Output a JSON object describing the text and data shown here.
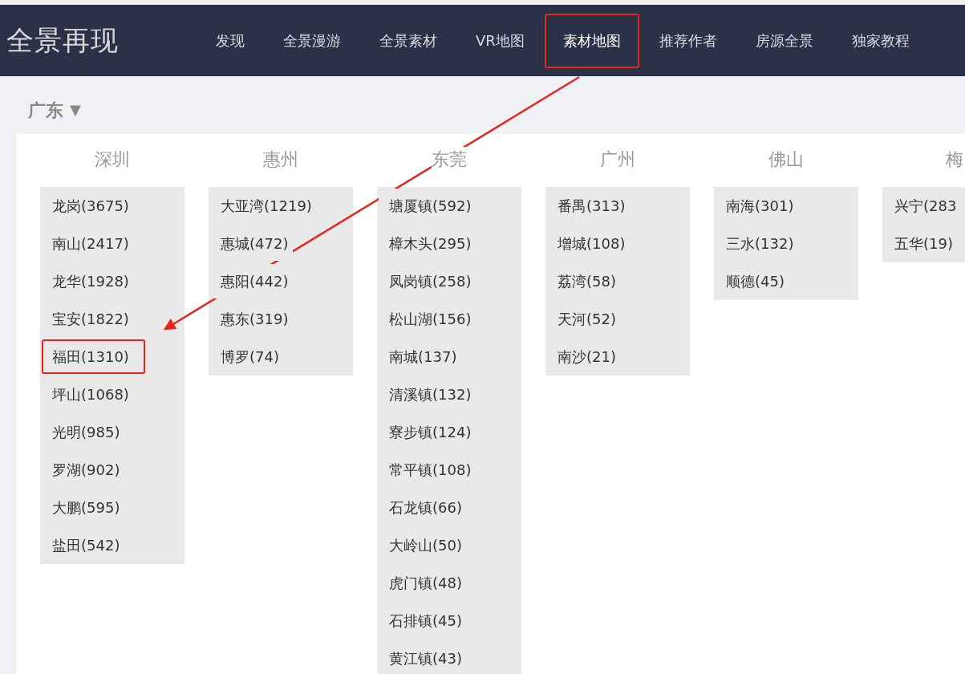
{
  "logo": "全景再现",
  "nav": [
    {
      "label": "发现",
      "highlighted": false
    },
    {
      "label": "全景漫游",
      "highlighted": false
    },
    {
      "label": "全景素材",
      "highlighted": false
    },
    {
      "label": "VR地图",
      "highlighted": false
    },
    {
      "label": "素材地图",
      "highlighted": true
    },
    {
      "label": "推荐作者",
      "highlighted": false
    },
    {
      "label": "房源全景",
      "highlighted": false
    },
    {
      "label": "独家教程",
      "highlighted": false
    }
  ],
  "province": {
    "label": "广东",
    "caret": "▼"
  },
  "cities": [
    {
      "name": "深圳",
      "districts": [
        {
          "label": "龙岗(3675)",
          "highlighted": false
        },
        {
          "label": "南山(2417)",
          "highlighted": false
        },
        {
          "label": "龙华(1928)",
          "highlighted": false
        },
        {
          "label": "宝安(1822)",
          "highlighted": false
        },
        {
          "label": "福田(1310)",
          "highlighted": true
        },
        {
          "label": "坪山(1068)",
          "highlighted": false
        },
        {
          "label": "光明(985)",
          "highlighted": false
        },
        {
          "label": "罗湖(902)",
          "highlighted": false
        },
        {
          "label": "大鹏(595)",
          "highlighted": false
        },
        {
          "label": "盐田(542)",
          "highlighted": false
        }
      ]
    },
    {
      "name": "惠州",
      "districts": [
        {
          "label": "大亚湾(1219)",
          "highlighted": false
        },
        {
          "label": "惠城(472)",
          "highlighted": false
        },
        {
          "label": "惠阳(442)",
          "highlighted": false
        },
        {
          "label": "惠东(319)",
          "highlighted": false
        },
        {
          "label": "博罗(74)",
          "highlighted": false
        }
      ]
    },
    {
      "name": "东莞",
      "districts": [
        {
          "label": "塘厦镇(592)",
          "highlighted": false
        },
        {
          "label": "樟木头(295)",
          "highlighted": false
        },
        {
          "label": "凤岗镇(258)",
          "highlighted": false
        },
        {
          "label": "松山湖(156)",
          "highlighted": false
        },
        {
          "label": "南城(137)",
          "highlighted": false
        },
        {
          "label": "清溪镇(132)",
          "highlighted": false
        },
        {
          "label": "寮步镇(124)",
          "highlighted": false
        },
        {
          "label": "常平镇(108)",
          "highlighted": false
        },
        {
          "label": "石龙镇(66)",
          "highlighted": false
        },
        {
          "label": "大岭山(50)",
          "highlighted": false
        },
        {
          "label": "虎门镇(48)",
          "highlighted": false
        },
        {
          "label": "石排镇(45)",
          "highlighted": false
        },
        {
          "label": "黄江镇(43)",
          "highlighted": false
        }
      ]
    },
    {
      "name": "广州",
      "districts": [
        {
          "label": "番禺(313)",
          "highlighted": false
        },
        {
          "label": "增城(108)",
          "highlighted": false
        },
        {
          "label": "荔湾(58)",
          "highlighted": false
        },
        {
          "label": "天河(52)",
          "highlighted": false
        },
        {
          "label": "南沙(21)",
          "highlighted": false
        }
      ]
    },
    {
      "name": "佛山",
      "districts": [
        {
          "label": "南海(301)",
          "highlighted": false
        },
        {
          "label": "三水(132)",
          "highlighted": false
        },
        {
          "label": "顺德(45)",
          "highlighted": false
        }
      ]
    },
    {
      "name": "梅",
      "districts": [
        {
          "label": "兴宁(283",
          "highlighted": false
        },
        {
          "label": "五华(19)",
          "highlighted": false
        }
      ]
    }
  ]
}
